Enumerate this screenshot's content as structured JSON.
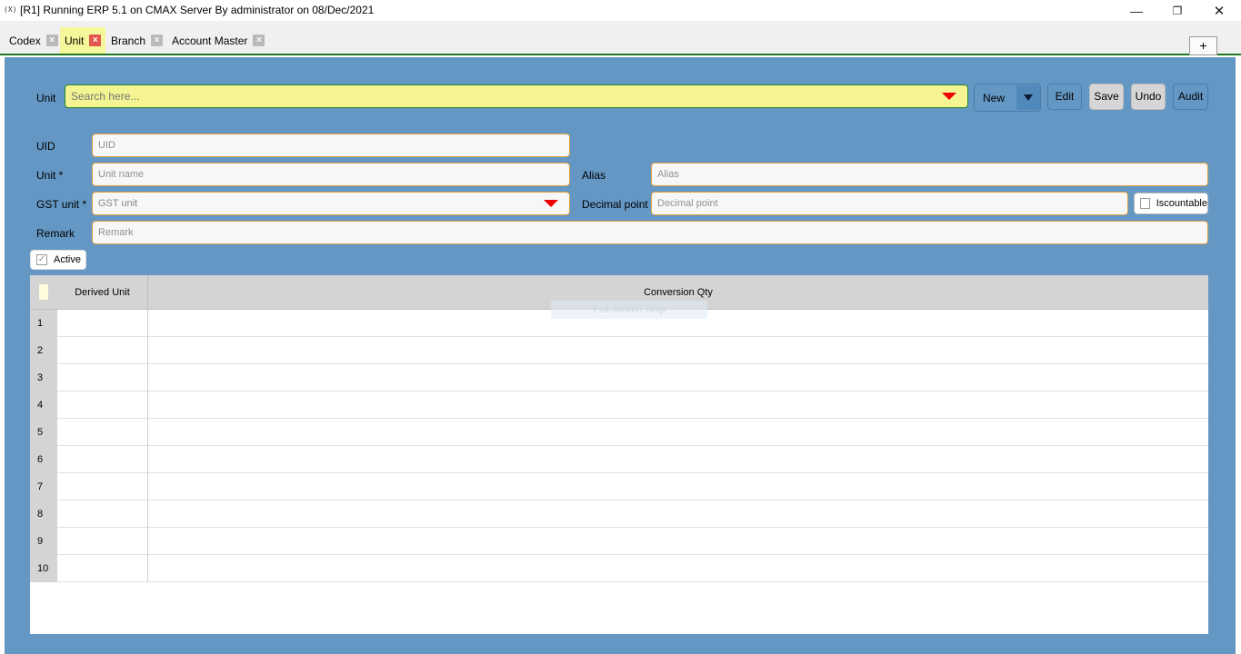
{
  "window": {
    "app_icon": "(X)",
    "title": "[R1] Running ERP 5.1 on CMAX Server By administrator on 08/Dec/2021",
    "min_icon": "—",
    "max_icon": "❐",
    "close_icon": "✕"
  },
  "tabs": [
    {
      "label": "Codex",
      "active": false
    },
    {
      "label": "Unit",
      "active": true
    },
    {
      "label": "Branch",
      "active": false
    },
    {
      "label": "Account Master",
      "active": false
    }
  ],
  "add_tab_label": "+",
  "toolbar": {
    "unit_label": "Unit",
    "search_placeholder": "Search here...",
    "new_label": "New",
    "edit_label": "Edit",
    "save_label": "Save",
    "undo_label": "Undo",
    "audit_label": "Audit"
  },
  "form": {
    "uid_label": "UID",
    "uid_placeholder": "UID",
    "unit_label": "Unit *",
    "unit_placeholder": "Unit name",
    "alias_label": "Alias",
    "alias_placeholder": "Alias",
    "gst_label": "GST unit *",
    "gst_placeholder": "GST unit",
    "decimal_label": "Decimal point",
    "decimal_placeholder": "Decimal point",
    "iscountable_label": "Iscountable",
    "iscountable_checked": false,
    "remark_label": "Remark",
    "remark_placeholder": "Remark",
    "active_label": "Active",
    "active_checked": true,
    "active_mark": "✓"
  },
  "grid": {
    "columns": [
      "Derived Unit",
      "Conversion Qty"
    ],
    "rows": [
      {
        "num": "1",
        "derived_unit": "",
        "conversion_qty": ""
      },
      {
        "num": "2",
        "derived_unit": "",
        "conversion_qty": ""
      },
      {
        "num": "3",
        "derived_unit": "",
        "conversion_qty": ""
      },
      {
        "num": "4",
        "derived_unit": "",
        "conversion_qty": ""
      },
      {
        "num": "5",
        "derived_unit": "",
        "conversion_qty": ""
      },
      {
        "num": "6",
        "derived_unit": "",
        "conversion_qty": ""
      },
      {
        "num": "7",
        "derived_unit": "",
        "conversion_qty": ""
      },
      {
        "num": "8",
        "derived_unit": "",
        "conversion_qty": ""
      },
      {
        "num": "9",
        "derived_unit": "",
        "conversion_qty": ""
      },
      {
        "num": "10",
        "derived_unit": "",
        "conversion_qty": ""
      }
    ],
    "overlay_text": "Full-screen Snip"
  },
  "colors": {
    "panel": "#6497c4",
    "search_bg": "#f4f493",
    "active_tab": "#f6f69a",
    "field_border": "#e0a040",
    "dropdown_arrow": "#e00000"
  }
}
